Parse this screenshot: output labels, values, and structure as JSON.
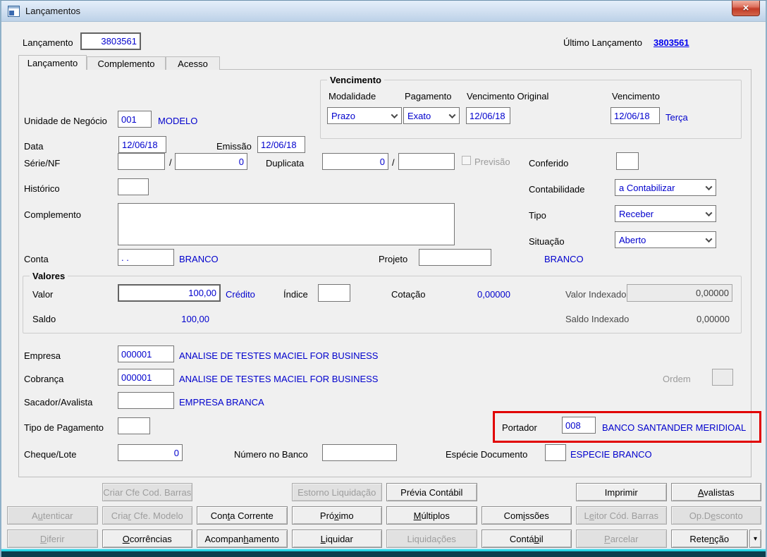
{
  "window": {
    "title": "Lançamentos"
  },
  "header": {
    "lancamento_label": "Lançamento",
    "lancamento_value": "3803561",
    "ultimo_lancamento_label": "Último Lançamento",
    "ultimo_lancamento_value": "3803561"
  },
  "tabs": {
    "lancamento": "Lançamento",
    "complemento": "Complemento",
    "acesso": "Acesso"
  },
  "form": {
    "unidade_negocio": {
      "label": "Unidade de Negócio",
      "value": "001",
      "desc": "MODELO"
    },
    "data": {
      "label": "Data",
      "value": "12/06/18"
    },
    "emissao": {
      "label": "Emissão",
      "value": "12/06/18"
    },
    "vencimento_group": {
      "title": "Vencimento",
      "modalidade": {
        "label": "Modalidade",
        "value": "Prazo"
      },
      "pagamento": {
        "label": "Pagamento",
        "value": "Exato"
      },
      "vencimento_original": {
        "label": "Vencimento Original",
        "value": "12/06/18"
      },
      "vencimento": {
        "label": "Vencimento",
        "value": "12/06/18",
        "weekday": "Terça"
      }
    },
    "serie_nf": {
      "label": "Série/NF",
      "serie": "",
      "sep": "/",
      "nf": "0"
    },
    "duplicata": {
      "label": "Duplicata",
      "numero": "0",
      "sep": "/",
      "parcela": ""
    },
    "previsao": {
      "label": "Previsão",
      "checked": false
    },
    "conferido": {
      "label": "Conferido",
      "value": ""
    },
    "historico": {
      "label": "Histórico",
      "value": ""
    },
    "contabilidade": {
      "label": "Contabilidade",
      "value": "a Contabilizar"
    },
    "complemento": {
      "label": "Complemento",
      "value": ""
    },
    "tipo": {
      "label": "Tipo",
      "value": "Receber"
    },
    "situacao": {
      "label": "Situação",
      "value": "Aberto"
    },
    "conta": {
      "label": "Conta",
      "value": ". .",
      "desc": "BRANCO"
    },
    "projeto": {
      "label": "Projeto",
      "value": "",
      "desc": "BRANCO"
    },
    "valores_group": {
      "title": "Valores",
      "valor": {
        "label": "Valor",
        "value": "100,00",
        "desc": "Crédito"
      },
      "indice": {
        "label": "Índice",
        "value": ""
      },
      "cotacao": {
        "label": "Cotação",
        "value": "0,00000"
      },
      "valor_indexado": {
        "label": "Valor Indexado",
        "value": "0,00000"
      },
      "saldo": {
        "label": "Saldo",
        "value": "100,00"
      },
      "saldo_indexado": {
        "label": "Saldo Indexado",
        "value": "0,00000"
      }
    },
    "empresa": {
      "label": "Empresa",
      "value": "000001",
      "desc": "ANALISE DE TESTES MACIEL FOR BUSINESS"
    },
    "cobranca": {
      "label": "Cobrança",
      "value": "000001",
      "desc": "ANALISE DE TESTES MACIEL FOR BUSINESS"
    },
    "ordem": {
      "label": "Ordem",
      "value": ""
    },
    "sacador_avalista": {
      "label": "Sacador/Avalista",
      "value": "",
      "desc": "EMPRESA BRANCA"
    },
    "tipo_pagamento": {
      "label": "Tipo de Pagamento",
      "value": ""
    },
    "portador": {
      "label": "Portador",
      "value": "008",
      "desc": "BANCO SANTANDER MERIDIOAL"
    },
    "cheque_lote": {
      "label": "Cheque/Lote",
      "value": "0"
    },
    "numero_banco": {
      "label": "Número no Banco",
      "value": ""
    },
    "especie_documento": {
      "label": "Espécie Documento",
      "value": "",
      "desc": "ESPECIE BRANCO"
    }
  },
  "buttons": {
    "rows": [
      [
        null,
        {
          "text": "Criar Cfe Cod. Barras",
          "enabled": false
        },
        null,
        {
          "text": "Estorno Liquidação",
          "enabled": false
        },
        {
          "text": "Prévia Contábil",
          "enabled": true
        },
        null,
        {
          "text": "Imprimir",
          "enabled": true
        },
        {
          "text": "Avalistas",
          "u": 0,
          "enabled": true
        }
      ],
      [
        {
          "text": "Autenticar",
          "u": 1,
          "enabled": false
        },
        {
          "text": "Criar Cfe. Modelo",
          "u": 4,
          "enabled": false
        },
        {
          "text": "Conta Corrente",
          "u": 3,
          "enabled": true
        },
        {
          "text": "Próximo",
          "u": 3,
          "enabled": true
        },
        {
          "text": "Múltiplos",
          "u": 0,
          "enabled": true
        },
        {
          "text": "Comissões",
          "u": 3,
          "enabled": true
        },
        {
          "text": "Leitor Cód. Barras",
          "u": 1,
          "enabled": false
        },
        {
          "text": "Op.Desconto",
          "u": 4,
          "enabled": false
        }
      ],
      [
        {
          "text": "Diferir",
          "u": 0,
          "enabled": false
        },
        {
          "text": "Ocorrências",
          "u": 0,
          "enabled": true
        },
        {
          "text": "Acompanhamento",
          "u": 7,
          "enabled": true
        },
        {
          "text": "Liquidar",
          "u": 0,
          "enabled": true
        },
        {
          "text": "Liquidações",
          "enabled": false
        },
        {
          "text": "Contábil",
          "u": 5,
          "enabled": true
        },
        {
          "text": "Parcelar",
          "u": 0,
          "enabled": false
        },
        {
          "text": "Retenção",
          "u": 4,
          "enabled": true,
          "split_arrow": "▾"
        }
      ]
    ]
  },
  "colors": {
    "value_text": "#0000CD",
    "link_text": "#0000EE",
    "highlight_border": "#e10000",
    "titlebar_gradient_top": "#e4eefa",
    "titlebar_gradient_bottom": "#bdd2e8",
    "close_button_red": "#c33b27",
    "window_bottom_cyan": "#28d4e4"
  }
}
